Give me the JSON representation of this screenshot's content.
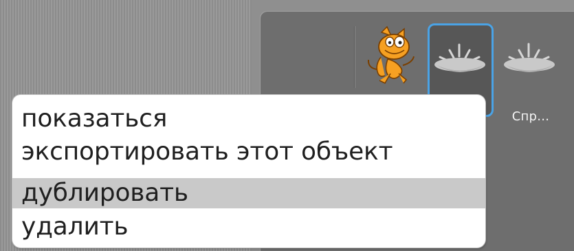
{
  "sprites": [
    {
      "label": "",
      "icon": "cat-icon",
      "selected": false
    },
    {
      "label": "",
      "icon": "fountain-icon",
      "selected": true
    },
    {
      "label": "Спр…",
      "icon": "fountain-icon",
      "selected": false
    }
  ],
  "context_menu": {
    "items": [
      "показаться",
      "экспортировать этот объект",
      "дублировать",
      "удалить"
    ],
    "highlighted_index": 2
  },
  "colors": {
    "selection_border": "#4aa3e6",
    "menu_highlight": "#c9c9c9",
    "pane_background": "#6e6e6e",
    "stage_background": "#8c8c8c"
  }
}
